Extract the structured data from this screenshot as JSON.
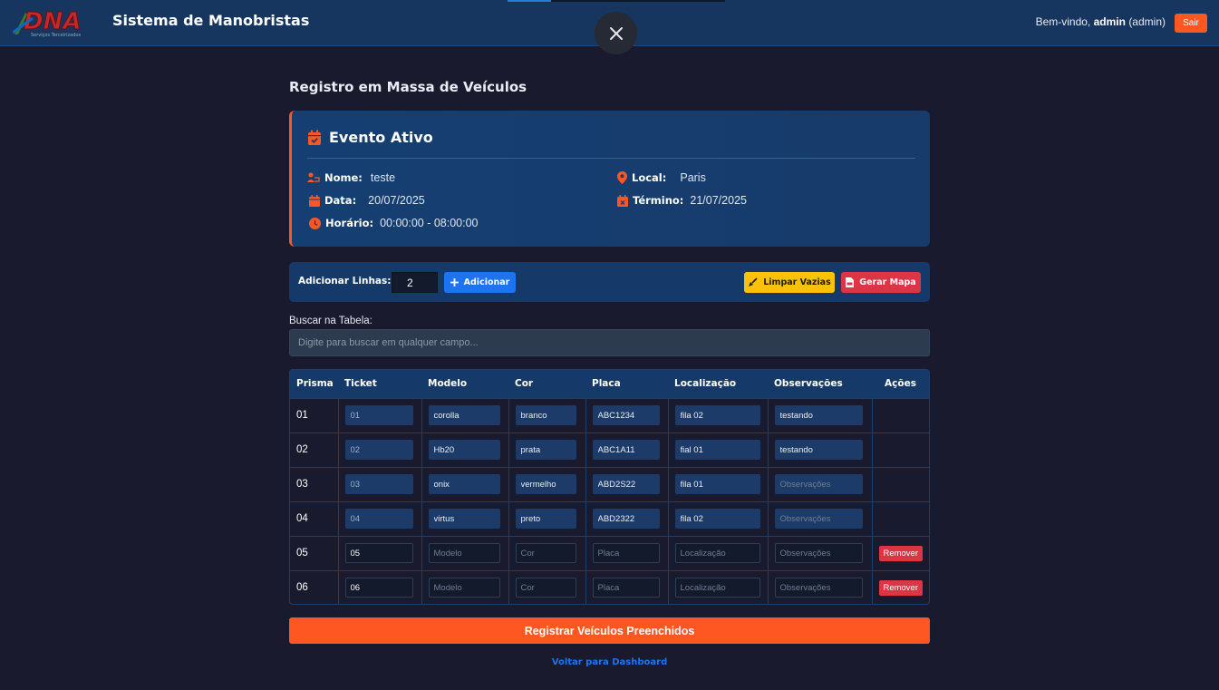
{
  "header": {
    "logo_text": "DNA",
    "logo_subtext": "Serviços Terceirizados",
    "app_title": "Sistema de Manobristas",
    "welcome_prefix": "Bem-vindo,",
    "username": "admin",
    "role": "(admin)",
    "logout_label": "Sair",
    "close_icon": "close-icon"
  },
  "page": {
    "title": "Registro em Massa de Veículos"
  },
  "event": {
    "title": "Evento Ativo",
    "name_label": "Nome:",
    "name_value": "teste",
    "location_label": "Local:",
    "location_value": "Paris",
    "date_label": "Data:",
    "date_value": "20/07/2025",
    "end_label": "Término:",
    "end_value": "21/07/2025",
    "time_label": "Horário:",
    "time_value": "00:00:00 - 08:00:00",
    "accent_color": "#ff5722"
  },
  "toolbar": {
    "add_rows_label": "Adicionar Linhas:",
    "add_rows_value": "2",
    "add_button": "Adicionar",
    "clear_button": "Limpar Vazias",
    "map_button": "Gerar Mapa"
  },
  "search": {
    "label": "Buscar na Tabela:",
    "placeholder": "Digite para buscar em qualquer campo..."
  },
  "table": {
    "headers": {
      "prisma": "Prisma",
      "ticket": "Ticket",
      "modelo": "Modelo",
      "cor": "Cor",
      "placa": "Placa",
      "localizacao": "Localização",
      "observacoes": "Observações",
      "acoes": "Ações"
    },
    "placeholders": {
      "modelo": "Modelo",
      "cor": "Cor",
      "placa": "Placa",
      "localizacao": "Localização",
      "observacoes": "Observações"
    },
    "remove_label": "Remover",
    "rows": [
      {
        "prisma": "01",
        "ticket": "01",
        "modelo": "corolla",
        "cor": "branco",
        "placa": "ABC1234",
        "localizacao": "fila 02",
        "observacoes": "testando"
      },
      {
        "prisma": "02",
        "ticket": "02",
        "modelo": "Hb20",
        "cor": "prata",
        "placa": "ABC1A11",
        "localizacao": "fial 01",
        "observacoes": "testando"
      },
      {
        "prisma": "03",
        "ticket": "03",
        "modelo": "onix",
        "cor": "vermelho",
        "placa": "ABD2S22",
        "localizacao": "fila 01",
        "observacoes": ""
      },
      {
        "prisma": "04",
        "ticket": "04",
        "modelo": "virtus",
        "cor": "preto",
        "placa": "ABD2322",
        "localizacao": "fila 02",
        "observacoes": ""
      },
      {
        "prisma": "05",
        "ticket": "05",
        "modelo": "",
        "cor": "",
        "placa": "",
        "localizacao": "",
        "observacoes": ""
      },
      {
        "prisma": "06",
        "ticket": "06",
        "modelo": "",
        "cor": "",
        "placa": "",
        "localizacao": "",
        "observacoes": ""
      }
    ]
  },
  "footer": {
    "submit_label": "Registrar Veículos Preenchidos",
    "back_label": "Voltar para Dashboard"
  }
}
